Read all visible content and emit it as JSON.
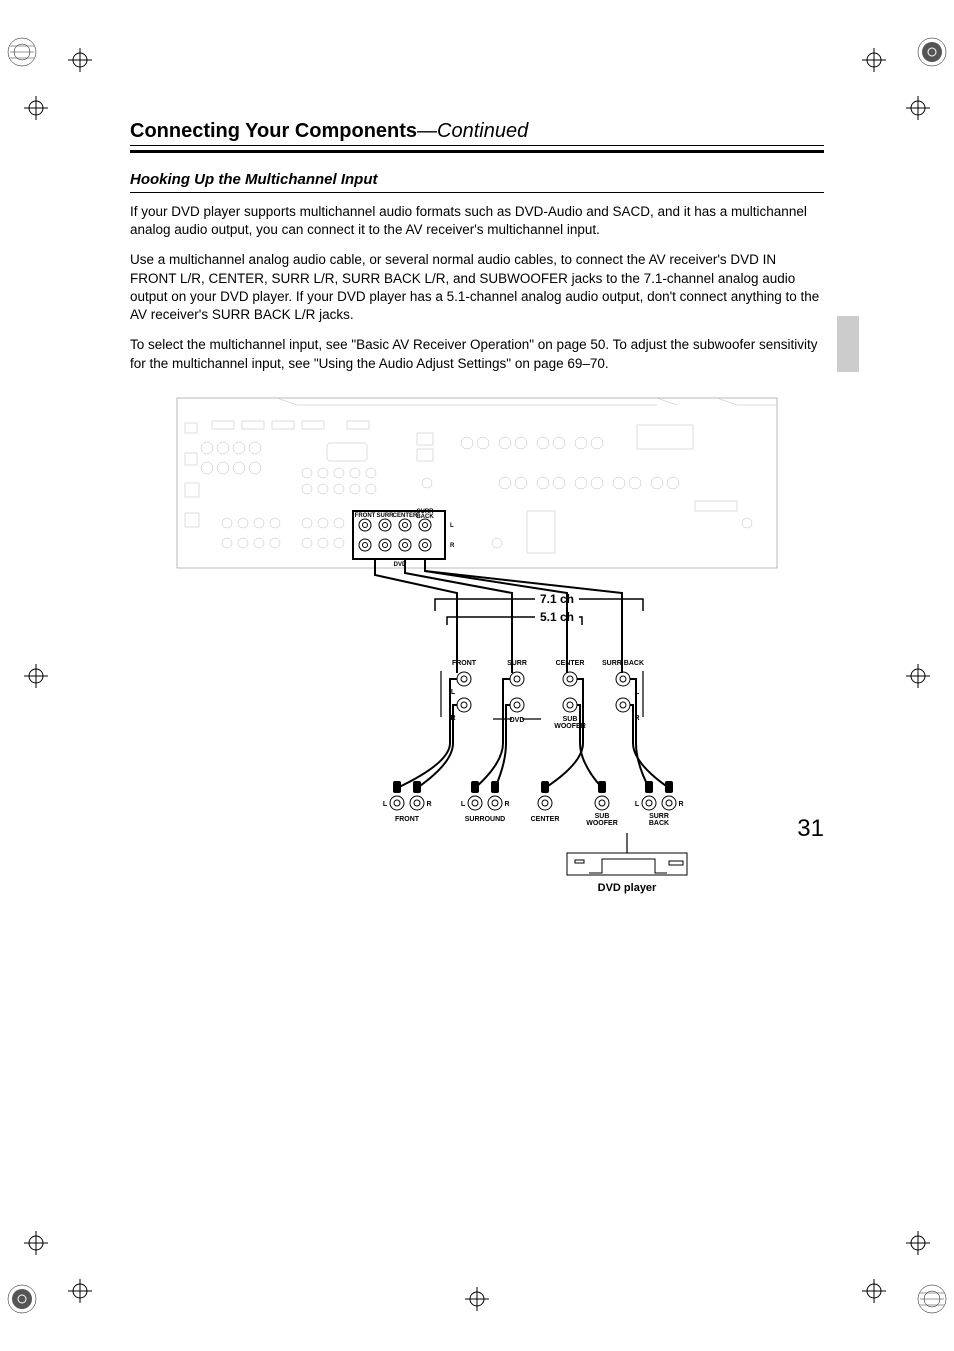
{
  "header": {
    "title": "Connecting Your Components",
    "continued": "—Continued"
  },
  "subsection": {
    "title": "Hooking Up the Multichannel Input"
  },
  "paragraphs": {
    "p1": "If your DVD player supports multichannel audio formats such as DVD-Audio and SACD, and it has a multichannel analog audio output, you can connect it to the AV receiver's multichannel input.",
    "p2": "Use a multichannel analog audio cable, or several normal audio cables, to connect the AV receiver's DVD IN FRONT L/R, CENTER, SURR L/R, SURR BACK L/R, and SUBWOOFER jacks to the 7.1-channel analog audio output on your DVD player. If your DVD player has a 5.1-channel analog audio output, don't connect anything to the AV receiver's SURR BACK L/R jacks.",
    "p3": "To select the multichannel input, see \"Basic AV Receiver Operation\" on page 50. To adjust the subwoofer sensitivity for the multichannel input, see \"Using the Audio Adjust Settings\" on page 69–70."
  },
  "diagram": {
    "ch71": "7.1 ch",
    "ch51": "5.1 ch",
    "front": "FRONT",
    "surr": "SURR",
    "center": "CENTER",
    "surr_back": "SURR BACK",
    "sub_woofer": "SUB",
    "sub_woofer2": "WOOFER",
    "dvd": "DVD",
    "l": "L",
    "r": "R",
    "surround": "SURROUND",
    "surr_back_label1": "SURR",
    "surr_back_label2": "BACK",
    "dvd_player": "DVD player"
  },
  "page_number": "31"
}
